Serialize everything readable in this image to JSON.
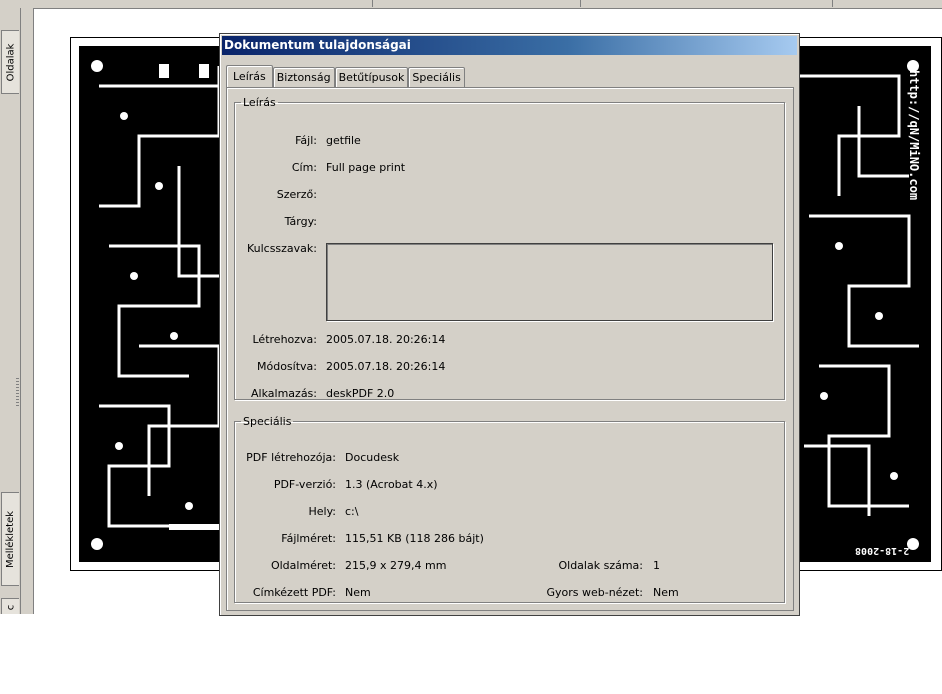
{
  "sidebar": {
    "tabs": [
      "Oldalak",
      "Mellékletek",
      "c"
    ]
  },
  "pcb": {
    "url_text": "http://qN/MiNO.com",
    "date_text": "2-18-2008"
  },
  "dialog": {
    "title": "Dokumentum tulajdonságai",
    "tabs": [
      "Leírás",
      "Biztonság",
      "Betűtípusok",
      "Speciális"
    ],
    "description": {
      "legend": "Leírás",
      "file_label": "Fájl:",
      "file_value": "getfile",
      "title_label": "Cím:",
      "title_value": "Full page print",
      "author_label": "Szerző:",
      "author_value": "",
      "subject_label": "Tárgy:",
      "subject_value": "",
      "keywords_label": "Kulcsszavak:",
      "keywords_value": "",
      "created_label": "Létrehozva:",
      "created_value": "2005.07.18. 20:26:14",
      "modified_label": "Módosítva:",
      "modified_value": "2005.07.18. 20:26:14",
      "application_label": "Alkalmazás:",
      "application_value": "deskPDF 2.0"
    },
    "advanced": {
      "legend": "Speciális",
      "producer_label": "PDF létrehozója:",
      "producer_value": "Docudesk",
      "version_label": "PDF-verzió:",
      "version_value": "1.3 (Acrobat 4.x)",
      "location_label": "Hely:",
      "location_value": "c:\\",
      "filesize_label": "Fájlméret:",
      "filesize_value": "115,51 KB (118 286 bájt)",
      "pagesize_label": "Oldalméret:",
      "pagesize_value": "215,9 x 279,4 mm",
      "pagecount_label": "Oldalak száma:",
      "pagecount_value": "1",
      "tagged_label": "Címkézett PDF:",
      "tagged_value": "Nem",
      "fastweb_label": "Gyors web-nézet:",
      "fastweb_value": "Nem"
    }
  },
  "colors": {
    "titlebar_start": "#0a246a",
    "titlebar_end": "#a6caf0",
    "face": "#d4d0c8"
  }
}
